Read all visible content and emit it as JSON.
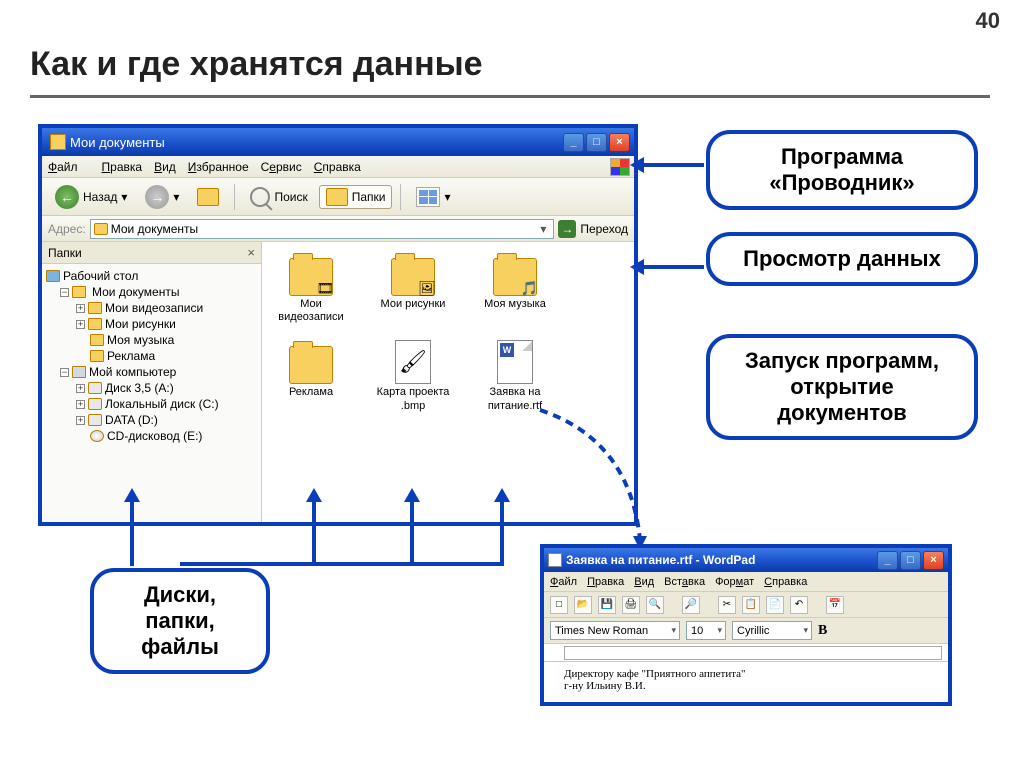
{
  "slide": {
    "number": "40",
    "title": "Как и где хранятся данные"
  },
  "explorer": {
    "title": "Мои документы",
    "menu": {
      "file": "Файл",
      "edit": "Правка",
      "view": "Вид",
      "favorites": "Избранное",
      "tools": "Сервис",
      "help": "Справка"
    },
    "toolbar": {
      "back": "Назад",
      "search": "Поиск",
      "folders": "Папки"
    },
    "address": {
      "label": "Адрес:",
      "value": "Мои документы",
      "go": "Переход"
    },
    "panel": {
      "title": "Папки"
    },
    "tree": {
      "desktop": "Рабочий стол",
      "mydocs": "Мои документы",
      "myvideo": "Мои видеозаписи",
      "mypics": "Мои рисунки",
      "mymusic": "Моя музыка",
      "ads": "Реклама",
      "mycomputer": "Мой компьютер",
      "floppy": "Диск 3,5 (A:)",
      "localc": "Локальный диск (C:)",
      "datad": "DATA (D:)",
      "cde": "CD-дисковод (E:)"
    },
    "files": {
      "myvideo": "Мои видеозаписи",
      "mypics": "Мои рисунки",
      "mymusic": "Моя музыка",
      "ads": "Реклама",
      "map": "Карта проекта .bmp",
      "request": "Заявка на питание.rtf"
    }
  },
  "callouts": {
    "explorer": "Программа «Проводник»",
    "view": "Просмотр данных",
    "launch": "Запуск программ, открытие документов",
    "disks": "Диски, папки, файлы"
  },
  "wordpad": {
    "title": "Заявка на питание.rtf - WordPad",
    "menu": {
      "file": "Файл",
      "edit": "Правка",
      "view": "Вид",
      "insert": "Вставка",
      "format": "Формат",
      "help": "Справка"
    },
    "font": "Times New Roman",
    "size": "10",
    "script": "Cyrillic",
    "bold": "В",
    "doc_line1": "Директору кафе \"Приятного аппетита\"",
    "doc_line2": "г-ну Ильину В.И."
  }
}
